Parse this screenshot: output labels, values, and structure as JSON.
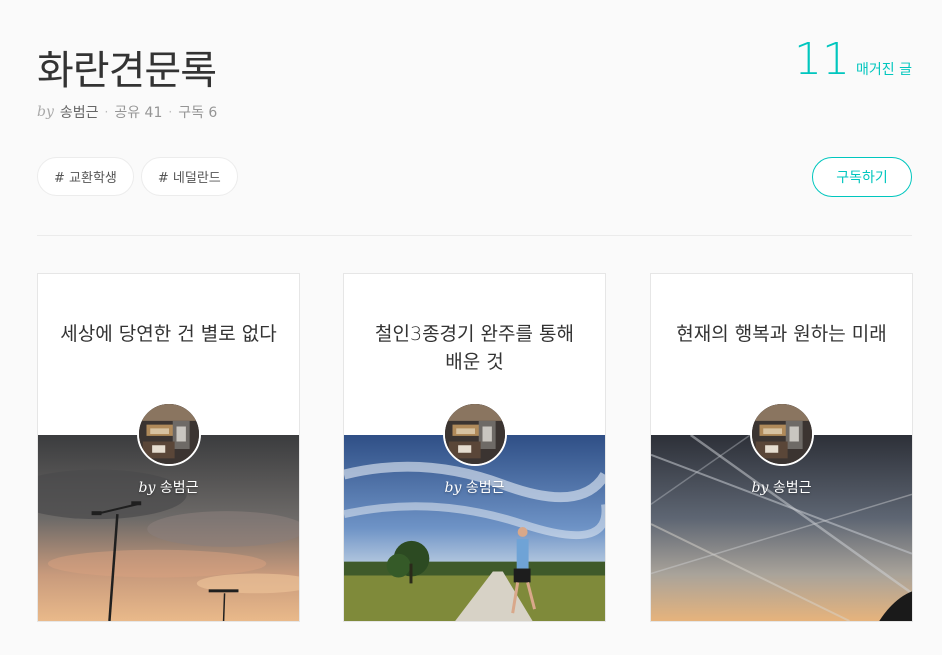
{
  "magazine": {
    "title": "화란견문록",
    "by": "by",
    "author": "송범근",
    "shares": "공유 41",
    "subscribers": "구독 6",
    "post_count": "11",
    "post_count_label": "매거진 글",
    "subscribe_label": "구독하기",
    "tags": [
      "# 교환학생",
      "# 네덜란드"
    ]
  },
  "cards": [
    {
      "title": "세상에 당연한 건 별로 없다",
      "by": "by",
      "author": "송범근"
    },
    {
      "title": "철인3종경기 완주를 통해 배운 것",
      "by": "by",
      "author": "송범근"
    },
    {
      "title": "현재의 행복과 원하는 미래",
      "by": "by",
      "author": "송범근"
    }
  ],
  "colors": {
    "accent": "#00c6be",
    "background": "#fafafa"
  }
}
